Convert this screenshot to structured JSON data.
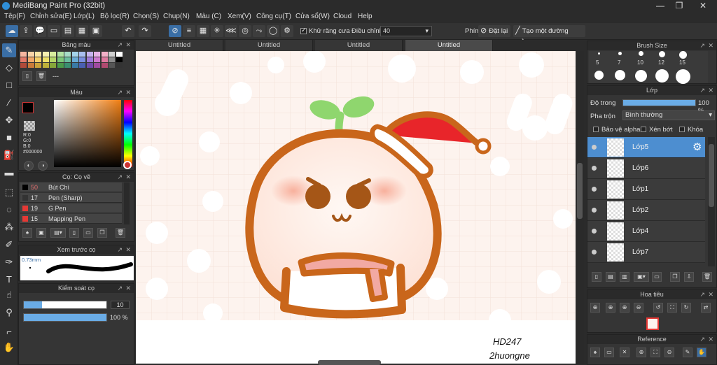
{
  "window": {
    "title": "MediBang Paint Pro (32bit)",
    "minimize": "—",
    "maximize": "❐",
    "close": "✕"
  },
  "menu": [
    "Tệp(F)",
    "Chỉnh sửa(E)",
    "Lớp(L)",
    "Bộ lọc(R)",
    "Chọn(S)",
    "Chụp(N)",
    "Màu (C)",
    "Xem(V)",
    "Công cụ(T)",
    "Cửa sổ(W)",
    "Cloud",
    "Help"
  ],
  "toolbar": {
    "antialias_label": "Khử răng cưa",
    "adjust_label": "Điều chỉnh",
    "adjust_value": "40",
    "key_label": "Phím",
    "reset_label": "Đặt lại",
    "straight_line_label": "Tạo một đường thẳng"
  },
  "doc_tabs": [
    "Untitled",
    "Untitled",
    "Untitled",
    "Untitled"
  ],
  "palette_panel": {
    "title": "Bảng màu",
    "name_value": "---"
  },
  "color_panel": {
    "title": "Màu",
    "r": "R:0",
    "g": "G:0",
    "b": "B:0",
    "hex": "#000000"
  },
  "brush_panel": {
    "title": "Cọ: Cọ vẽ",
    "brushes": [
      {
        "size": "50",
        "name": "Bút Chì",
        "color": "#000000"
      },
      {
        "size": "17",
        "name": "Pen (Sharp)",
        "color": "#333333"
      },
      {
        "size": "19",
        "name": "G Pen",
        "color": "#e53935"
      },
      {
        "size": "15",
        "name": "Mapping Pen",
        "color": "#e53935"
      }
    ]
  },
  "preview_panel": {
    "title": "Xem trước cọ",
    "size_label": "0.73mm"
  },
  "control_panel": {
    "title": "Kiểm soát cọ",
    "size_value": "10",
    "opacity_value": "100 %",
    "size_fraction": 0.22,
    "opacity_fraction": 1.0
  },
  "brush_size_panel": {
    "title": "Brush Size",
    "sizes": [
      "5",
      "7",
      "10",
      "12",
      "15"
    ]
  },
  "layer_panel": {
    "title": "Lớp",
    "opacity_label": "Độ trong",
    "opacity_value": "100 %",
    "blend_label": "Pha trộn",
    "blend_value": "Bình thường",
    "protect_alpha": "Bảo vệ alpha",
    "clipping": "Xén bớt",
    "lock": "Khóa",
    "layers": [
      "Lớp5",
      "Lớp6",
      "Lớp1",
      "Lớp2",
      "Lớp4",
      "Lớp7"
    ]
  },
  "navigator_panel": {
    "title": "Hoa tiêu"
  },
  "reference_panel": {
    "title": "Reference"
  },
  "artwork": {
    "signature_line1": "HD247",
    "signature_line2": "2huongne"
  },
  "colors": {
    "accent": "#3a6ea5",
    "selected_layer": "#4d8ed0",
    "outline": "#c9661b",
    "canvas_bg": "#fdf3ee",
    "leaf": "#8fd66e",
    "hat": "#e8252a"
  }
}
